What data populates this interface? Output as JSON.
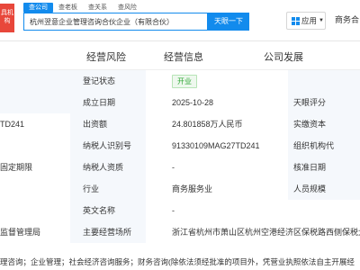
{
  "header": {
    "logo_text": "具机构",
    "tabs": [
      "查公司",
      "查老板",
      "查关系",
      "查风险"
    ],
    "search_value": "杭州翌意企业管理咨询合伙企业（有限合伙）",
    "search_button": "天眼一下",
    "app_button": "应用",
    "business_link": "商务合"
  },
  "section_nav": [
    "经营风险",
    "经营信息",
    "公司发展"
  ],
  "left_fragments": {
    "code": "TD241",
    "fixed_term": "固定期限",
    "supervisor": "监督管理局"
  },
  "rows": [
    {
      "label": "登记状态",
      "value": "开业",
      "value_is_badge": true,
      "right_label": ""
    },
    {
      "label": "成立日期",
      "value": "2025-10-28",
      "right_label": "天眼评分"
    },
    {
      "label": "出资额",
      "value": "24.801858万人民币",
      "right_label": "实缴资本"
    },
    {
      "label": "纳税人识别号",
      "value": "91330109MAG27TD241",
      "right_label": "组织机构代"
    },
    {
      "label": "纳税人资质",
      "value": "-",
      "right_label": "核准日期"
    },
    {
      "label": "行业",
      "value": "商务服务业",
      "right_label": "人员规模"
    },
    {
      "label": "英文名称",
      "value": "-",
      "right_label": ""
    },
    {
      "label": "主要经营场所",
      "value": "浙江省杭州市萧山区杭州空港经济区保税路西侧保税大",
      "right_label": ""
    }
  ],
  "bottom_text": "理咨询；企业管理；社会经济咨询服务；财务咨询(除依法须经批准的项目外，凭营业执照依法自主开展经"
}
